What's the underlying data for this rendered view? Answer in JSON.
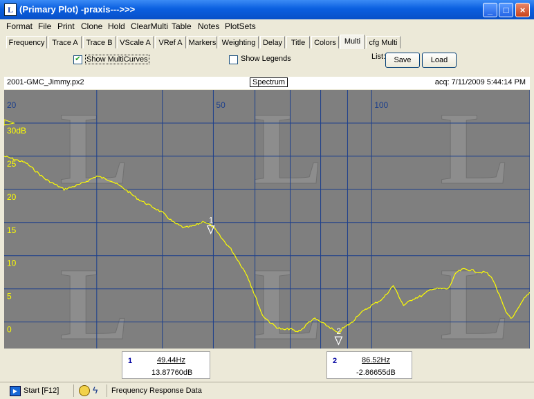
{
  "window": {
    "title": "(Primary Plot) -praxis--->>>",
    "icon": "praxis-logo-icon"
  },
  "menu": [
    "Format",
    "File",
    "Print",
    "Clone",
    "Hold",
    "ClearMulti",
    "Table",
    "Notes",
    "PlotSets"
  ],
  "tabs": [
    "Frequency",
    "Trace A",
    "Trace B",
    "VScale A",
    "VRef A",
    "Markers",
    "Weighting",
    "Delay",
    "Title",
    "Colors",
    "Multi",
    "cfg Multi"
  ],
  "active_tab": "Multi",
  "multi": {
    "show_multicurves": {
      "label": "Show MultiCurves",
      "checked": true
    },
    "show_legends": {
      "label": "Show Legends",
      "checked": false
    },
    "list_label": "List:",
    "save_label": "Save",
    "load_label": "Load"
  },
  "info": {
    "filename": "2001-GMC_Jimmy.px2",
    "mode": "Spectrum",
    "acq": "acq: 7/11/2009 5:44:14 PM"
  },
  "chart_data": {
    "type": "line",
    "x_scale": "log",
    "xlim": [
      20,
      200
    ],
    "ylim": [
      -4,
      35
    ],
    "x_tick_labels": [
      {
        "x": 20,
        "label": "20"
      },
      {
        "x": 50,
        "label": "50"
      },
      {
        "x": 100,
        "label": "100"
      }
    ],
    "x_grid": [
      30,
      40,
      50,
      60,
      70,
      80,
      90,
      100,
      200
    ],
    "y_ticks": [
      {
        "y": 30,
        "label": "30dB"
      },
      {
        "y": 25,
        "label": "25"
      },
      {
        "y": 20,
        "label": "20"
      },
      {
        "y": 15,
        "label": "15"
      },
      {
        "y": 10,
        "label": "10"
      },
      {
        "y": 5,
        "label": "5"
      },
      {
        "y": 0,
        "label": "0"
      }
    ],
    "grid": true,
    "series_color": "#ffff00",
    "series": [
      {
        "x": [
          20,
          22,
          24,
          26,
          28,
          30,
          32,
          34,
          36,
          38,
          40,
          42,
          44,
          46,
          48,
          50,
          52,
          54,
          56,
          58,
          60,
          62,
          64,
          66,
          68,
          70,
          72,
          74,
          76,
          78,
          80,
          82,
          84,
          86.5,
          88,
          90,
          92,
          94,
          96,
          98,
          100,
          105,
          110,
          115,
          120,
          125,
          130,
          135,
          140,
          145,
          150,
          155,
          160,
          165,
          170,
          175,
          180,
          185,
          190,
          195,
          200
        ],
        "y": [
          25,
          24,
          21.5,
          20,
          20.8,
          22,
          21.3,
          20,
          18.5,
          17.5,
          16.5,
          15,
          14.2,
          14.5,
          15.2,
          14.3,
          12.5,
          11,
          9,
          7,
          4,
          1,
          0,
          -0.8,
          -1.2,
          -1,
          -1.5,
          -1,
          0,
          0.5,
          0,
          -0.5,
          -1,
          -1.8,
          -1,
          -0.5,
          0,
          1,
          1.5,
          2,
          2.5,
          3.5,
          5.5,
          2.5,
          3.5,
          4,
          5,
          5,
          5,
          7.5,
          8,
          7.8,
          7.5,
          7.5,
          6.5,
          4,
          1.5,
          0.5,
          2,
          3.5,
          4.5
        ]
      }
    ],
    "markers": [
      {
        "label": "1",
        "x": 49.44,
        "y": 13.8776
      },
      {
        "label": "2",
        "x": 86.52,
        "y": -2.86655
      }
    ]
  },
  "marker_readouts": [
    {
      "n": "1",
      "freq": "49.44Hz",
      "value": "13.87760dB"
    },
    {
      "n": "2",
      "freq": "86.52Hz",
      "value": "-2.86655dB"
    }
  ],
  "status": {
    "start": "Start [F12]",
    "text": "Frequency Response Data"
  }
}
